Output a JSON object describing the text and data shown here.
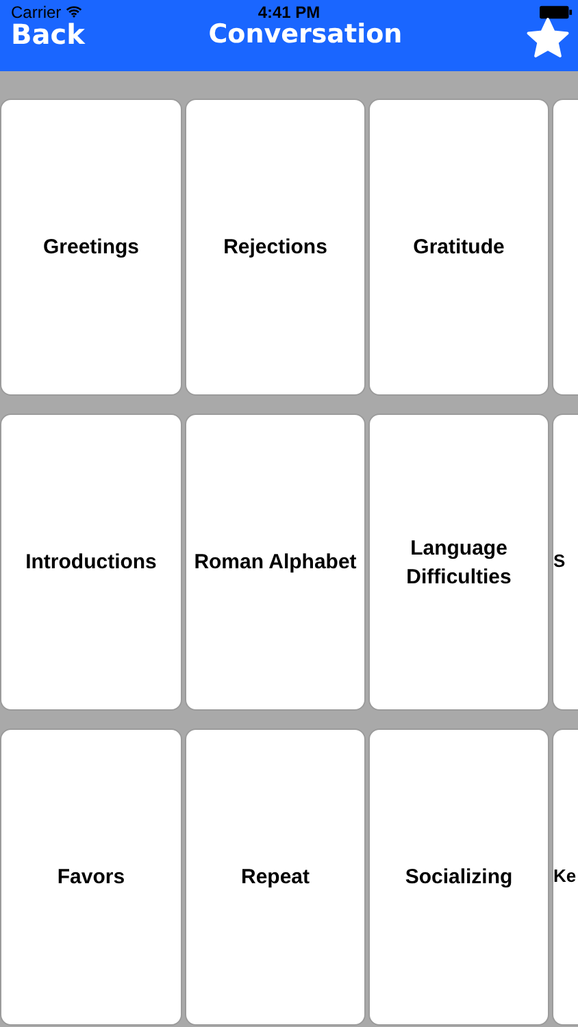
{
  "status_bar": {
    "carrier": "Carrier",
    "time": "4:41 PM"
  },
  "nav": {
    "back": "Back",
    "title": "Conversation"
  },
  "cards": [
    {
      "kind": "full",
      "label": "Greetings"
    },
    {
      "kind": "full",
      "label": "Rejections"
    },
    {
      "kind": "full",
      "label": "Gratitude"
    },
    {
      "kind": "cut"
    },
    {
      "kind": "full",
      "label": "Introductions"
    },
    {
      "kind": "full",
      "label": "Roman Alphabet"
    },
    {
      "kind": "full",
      "label": "Language Difficulties"
    },
    {
      "kind": "cut",
      "label": "S"
    },
    {
      "kind": "full",
      "label": "Favors"
    },
    {
      "kind": "full",
      "label": "Repeat"
    },
    {
      "kind": "full",
      "label": "Socializing"
    },
    {
      "kind": "cut",
      "label": "Ke"
    }
  ]
}
